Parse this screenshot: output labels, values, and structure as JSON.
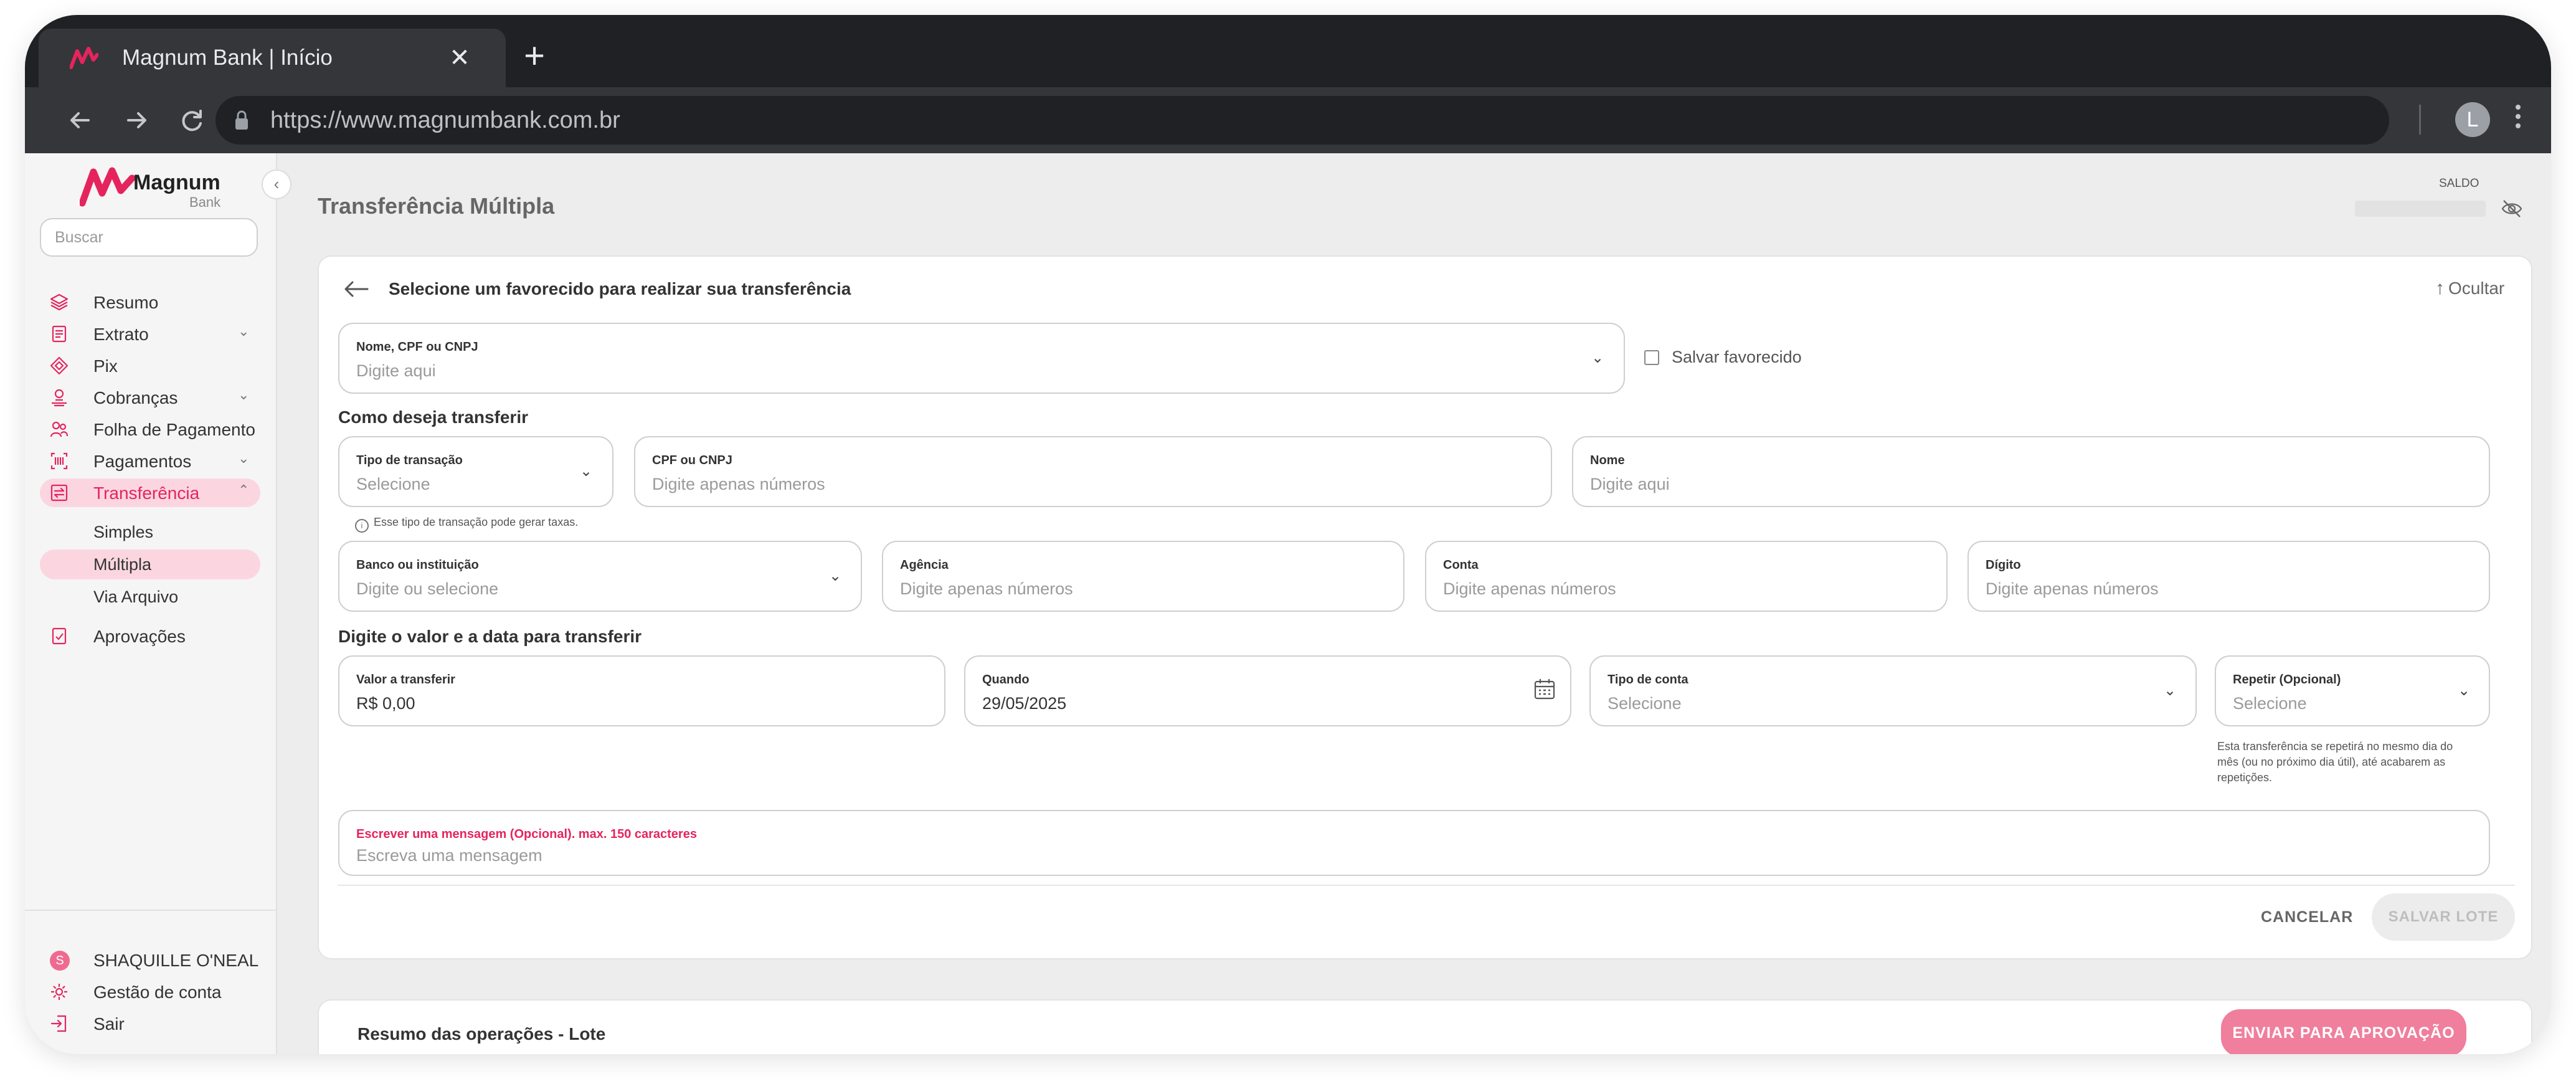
{
  "browser": {
    "tab_title": "Magnum Bank  |  Início",
    "close_glyph": "✕",
    "new_tab_glyph": "+",
    "url": "https://www.magnumbank.com.br",
    "profile_initial": "L"
  },
  "brand": {
    "name": "Magnum",
    "sub": "Bank",
    "color": "#e5245e"
  },
  "sidebar": {
    "search_placeholder": "Buscar",
    "items": [
      {
        "label": "Resumo",
        "icon": "layers-icon",
        "chevron": false
      },
      {
        "label": "Extrato",
        "icon": "document-icon",
        "chevron": true
      },
      {
        "label": "Pix",
        "icon": "pix-icon",
        "chevron": false
      },
      {
        "label": "Cobranças",
        "icon": "billing-icon",
        "chevron": true
      },
      {
        "label": "Folha de Pagamento",
        "icon": "people-icon",
        "chevron": false
      },
      {
        "label": "Pagamentos",
        "icon": "barcode-icon",
        "chevron": true
      },
      {
        "label": "Transferência",
        "icon": "transfer-icon",
        "chevron": true,
        "active": true
      }
    ],
    "sub_items": [
      {
        "label": "Simples"
      },
      {
        "label": "Múltipla",
        "active": true
      },
      {
        "label": "Via Arquivo"
      }
    ],
    "approvals": "Aprovações",
    "user_initial": "S",
    "user_name": "SHAQUILLE O'NEAL",
    "account_mgmt": "Gestão de conta",
    "logout": "Sair"
  },
  "header": {
    "title": "Transferência Múltipla",
    "saldo_label": "SALDO"
  },
  "form": {
    "heading": "Selecione um favorecido para realizar sua transferência",
    "hide_label": "Ocultar",
    "beneficiary": {
      "label": "Nome, CPF ou CNPJ",
      "placeholder": "Digite aqui"
    },
    "save_favorite": "Salvar favorecido",
    "section_how": "Como deseja transferir",
    "tx_type": {
      "label": "Tipo de transação",
      "placeholder": "Selecione"
    },
    "cpf_cnpj": {
      "label": "CPF ou CNPJ",
      "placeholder": "Digite apenas números"
    },
    "name": {
      "label": "Nome",
      "placeholder": "Digite aqui"
    },
    "fee_hint": "Esse tipo de transação pode gerar taxas.",
    "bank": {
      "label": "Banco ou instituição",
      "placeholder": "Digite ou selecione"
    },
    "agency": {
      "label": "Agência",
      "placeholder": "Digite apenas números"
    },
    "account": {
      "label": "Conta",
      "placeholder": "Digite apenas números"
    },
    "digit": {
      "label": "Dígito",
      "placeholder": "Digite apenas números"
    },
    "section_value": "Digite o valor e a data para transferir",
    "amount": {
      "label": "Valor a transferir",
      "value": "R$ 0,00"
    },
    "when": {
      "label": "Quando",
      "value": "29/05/2025"
    },
    "account_type": {
      "label": "Tipo de conta",
      "placeholder": "Selecione"
    },
    "repeat": {
      "label": "Repetir (Opcional)",
      "placeholder": "Selecione"
    },
    "repeat_hint_1": "Esta transferência se repetirá no mesmo dia do",
    "repeat_hint_2": "mês (ou no próximo dia útil), até acabarem as",
    "repeat_hint_3": "repetições.",
    "message": {
      "label": "Escrever uma mensagem (Opcional). max. 150 caracteres",
      "placeholder": "Escreva uma mensagem"
    },
    "cancel": "CANCELAR",
    "save_batch": "SALVAR LOTE"
  },
  "summary": {
    "title": "Resumo das operações - Lote",
    "send_button": "ENVIAR PARA APROVAÇÃO"
  }
}
